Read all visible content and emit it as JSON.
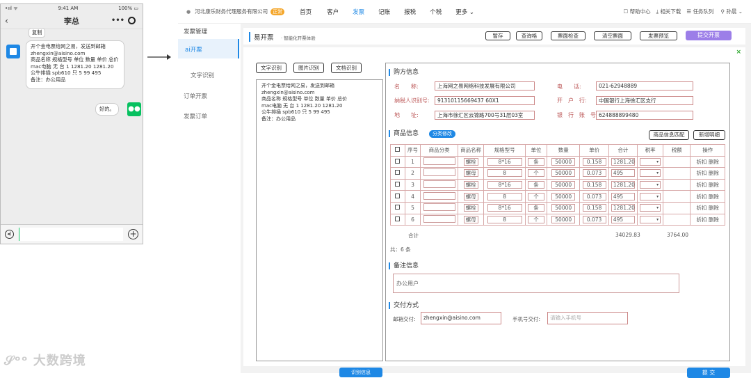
{
  "phone": {
    "time": "9:41 AM",
    "battery": "100%",
    "contact": "李总",
    "copy_label": "复制",
    "message_lines": [
      "开个金电票给网之易，发送到邮箱",
      "zhengxin@aisino.com",
      "商品名称 规格型号 单位 数量 单价 总价",
      "mac电脑 无 台 1 1281.20 1281.20",
      "公牛排插 spb610 只 5 99 495",
      "备注：办公用品"
    ],
    "reply": "好的。"
  },
  "nav": {
    "company": "河北康乐财务代理服务有限公司",
    "tag": "正常",
    "items": [
      "首页",
      "客户",
      "发票",
      "记账",
      "报税",
      "个税",
      "更多"
    ],
    "right": [
      "帮助中心",
      "相关下载",
      "任务队列",
      "孙晨"
    ]
  },
  "sidebar": {
    "items": [
      "发票管理",
      "ai开票",
      "文字识别",
      "订单开票",
      "发票订单"
    ]
  },
  "header": {
    "title": "易开票",
    "subtitle": "· 智能化开票体验",
    "buttons": [
      "暂存",
      "查询格",
      "票面检查",
      "清空票面",
      "发票预览"
    ],
    "submit": "提交开票"
  },
  "left_panel": {
    "tabs": [
      "文字识别",
      "图片识别",
      "文档识别"
    ],
    "text_lines": [
      "开个金电票给网之易，发送到邮箱",
      "zhengxin@aisino.com",
      "商品名称 规格型号 单位 数量 单价 总价",
      "mac电脑 无 台 1 1281.20 1281.20",
      "公牛排插 spb610 只 5 99 495",
      "备注：办公用品"
    ],
    "recognize_button": "识别信息"
  },
  "buyer": {
    "section": "购方信息",
    "name_label": "名　　称:",
    "name": "上海网之易网络科技发展有限公司",
    "tax_label": "纳税人识别号:",
    "tax": "91310115669437 60X1",
    "addr_label": "地　　址:",
    "addr": "上海市徐汇区云锦路700号31层03室",
    "phone_label": "电　　话:",
    "phone": "021-62948889",
    "bank_label": "开　户　行:",
    "bank": "中国银行上海徐汇区支行",
    "account_label": "银　行　账　号:",
    "account": "624888899480"
  },
  "goods": {
    "section": "商品信息",
    "classify_button": "分类修改",
    "match_button": "商品信息匹配",
    "add_button": "新增明细",
    "headers": [
      "序号",
      "商品分类",
      "商品名称",
      "规格型号",
      "单位",
      "数量",
      "单价",
      "合计",
      "税率",
      "税额",
      "操作"
    ],
    "rows": [
      {
        "no": "1",
        "name": "螺栓",
        "spec": "8*16",
        "unit": "条",
        "qty": "50000",
        "price": "0.158",
        "total": "1281.20"
      },
      {
        "no": "2",
        "name": "螺母",
        "spec": "8",
        "unit": "个",
        "qty": "50000",
        "price": "0.073",
        "total": "495"
      },
      {
        "no": "3",
        "name": "螺栓",
        "spec": "8*16",
        "unit": "条",
        "qty": "50000",
        "price": "0.158",
        "total": "1281.20"
      },
      {
        "no": "4",
        "name": "螺母",
        "spec": "8",
        "unit": "个",
        "qty": "50000",
        "price": "0.073",
        "total": "495"
      },
      {
        "no": "5",
        "name": "螺栓",
        "spec": "8*16",
        "unit": "条",
        "qty": "50000",
        "price": "0.158",
        "total": "1281.20"
      },
      {
        "no": "6",
        "name": "螺母",
        "spec": "8",
        "unit": "个",
        "qty": "50000",
        "price": "0.073",
        "total": "495"
      }
    ],
    "op_discount": "折扣",
    "op_delete": "删除",
    "sum_label": "合计",
    "sum_total": "34029.83",
    "sum_tax": "3764.00",
    "count": "共：6 条"
  },
  "remark": {
    "section": "备注信息",
    "text": "办公用户"
  },
  "delivery": {
    "section": "交付方式",
    "email_label": "邮箱交付:",
    "email": "zhengxin@aisino.com",
    "phone_label": "手机号交付:",
    "phone_placeholder": "请输入手机号"
  },
  "footer": {
    "submit": "提 交"
  },
  "watermark": "大数跨境",
  "colors": {
    "accent": "#1e88e5",
    "wechat_green": "#07c160"
  }
}
